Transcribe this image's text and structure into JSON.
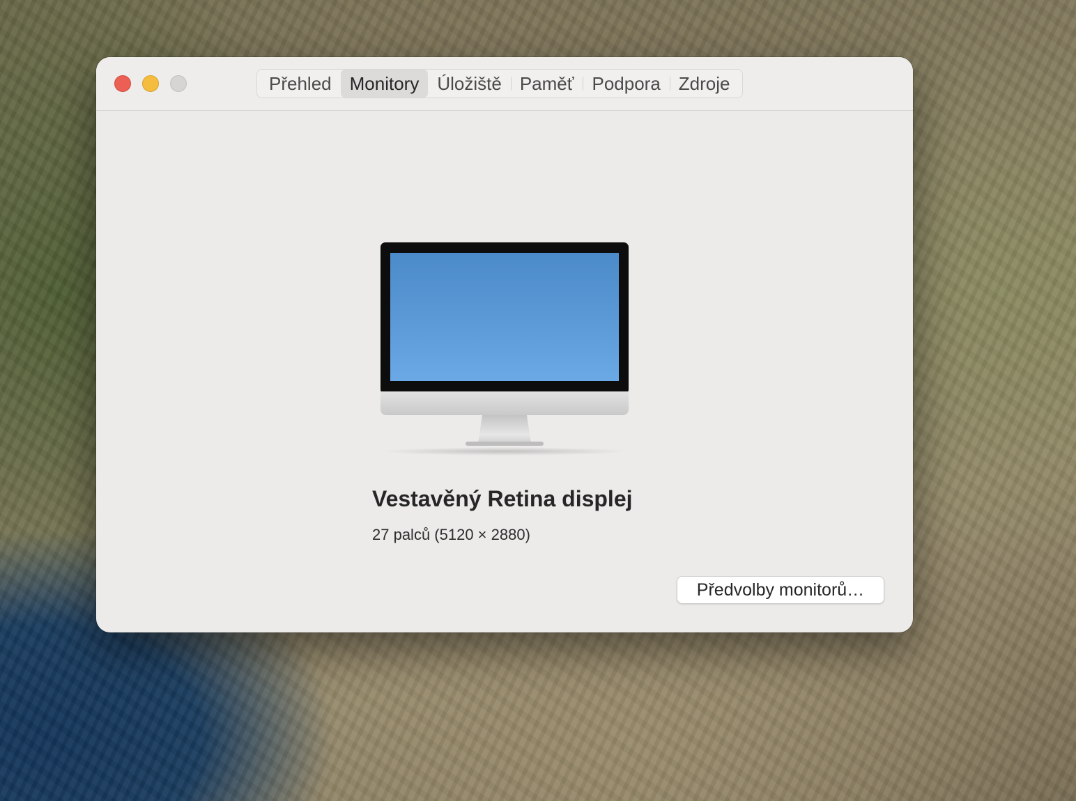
{
  "tabs": [
    {
      "label": "Přehled",
      "active": false
    },
    {
      "label": "Monitory",
      "active": true
    },
    {
      "label": "Úložiště",
      "active": false
    },
    {
      "label": "Paměť",
      "active": false
    },
    {
      "label": "Podpora",
      "active": false
    },
    {
      "label": "Zdroje",
      "active": false
    }
  ],
  "display": {
    "name": "Vestavěný Retina displej",
    "spec": "27 palců (5120 × 2880)",
    "icon": "imac-icon",
    "apple_logo": ""
  },
  "buttons": {
    "preferences": "Předvolby monitorů…"
  },
  "colors": {
    "close": "#ec5f55",
    "minimize": "#f4bd3f",
    "zoom": "#d6d5d3"
  }
}
